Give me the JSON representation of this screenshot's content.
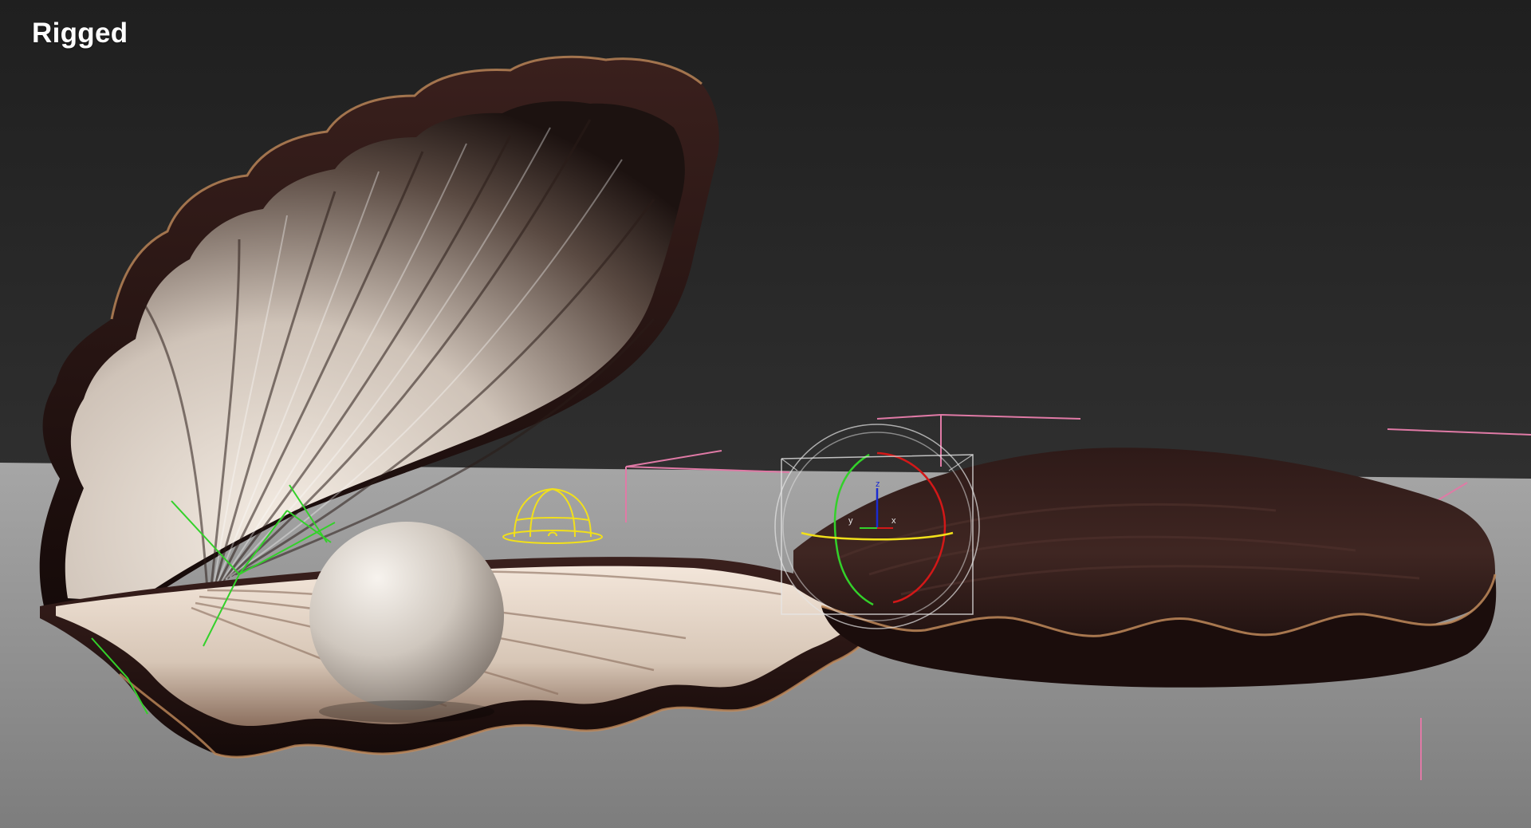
{
  "viewport": {
    "label": "Rigged"
  },
  "scene": {
    "colors": {
      "background_top": "#1f1f1f",
      "background_bottom": "#3a3a3a",
      "floor": "#8a8a8a",
      "floor_far": "#a3a3a3",
      "shell_dark": "#2a1614",
      "shell_rim": "#c08a5a",
      "shell_inner_light": "#eae0d6",
      "pearl": "#d9d2ca",
      "helper_pink": "#e07aa6",
      "helper_green": "#33d12a",
      "helper_yellow": "#f2e01a",
      "gizmo_red": "#d21818",
      "gizmo_blue": "#1a2bd0",
      "gizmo_white": "#e6e6e6"
    },
    "objects": [
      {
        "name": "open-shell-upper",
        "icon": "shell"
      },
      {
        "name": "open-shell-lower",
        "icon": "shell"
      },
      {
        "name": "pearl",
        "icon": "sphere"
      },
      {
        "name": "closed-shell",
        "icon": "shell"
      },
      {
        "name": "camera-helper",
        "icon": "dome-helper"
      },
      {
        "name": "rotate-gizmo",
        "icon": "rotate-gizmo"
      }
    ],
    "gizmo_axis_labels": {
      "x": "x",
      "y": "y",
      "z": "z"
    }
  }
}
